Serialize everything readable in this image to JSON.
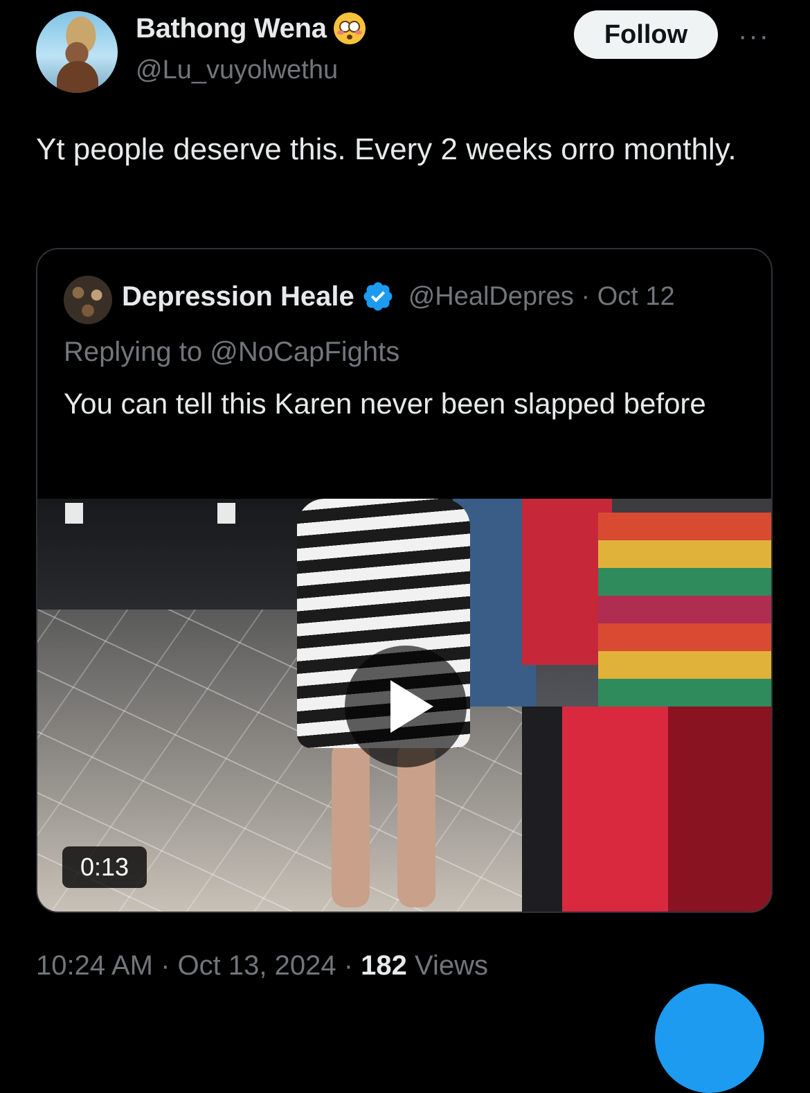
{
  "tweet": {
    "author_name": "Bathong Wena",
    "author_emoji": "flushed-face",
    "author_handle": "@Lu_vuyolwethu",
    "follow_label": "Follow",
    "more_label": "···",
    "text": "Yt people deserve this. Every 2 weeks orro monthly.",
    "timestamp": "10:24 AM · Oct 13, 2024 ·",
    "views_count": "182",
    "views_label": "Views"
  },
  "quoted": {
    "author_name": "Depression Heale",
    "verified": true,
    "meta": "@HealDepres · Oct 12",
    "replying_to": "Replying to @NoCapFights",
    "text": "You can tell this Karen  never been slapped before",
    "video": {
      "duration": "0:13",
      "play_icon": "play-icon"
    }
  },
  "colors": {
    "background": "#000000",
    "primary_text": "#e7e9ea",
    "secondary_text": "#71767b",
    "accent": "#1d9bf0",
    "border": "#2f3336"
  }
}
